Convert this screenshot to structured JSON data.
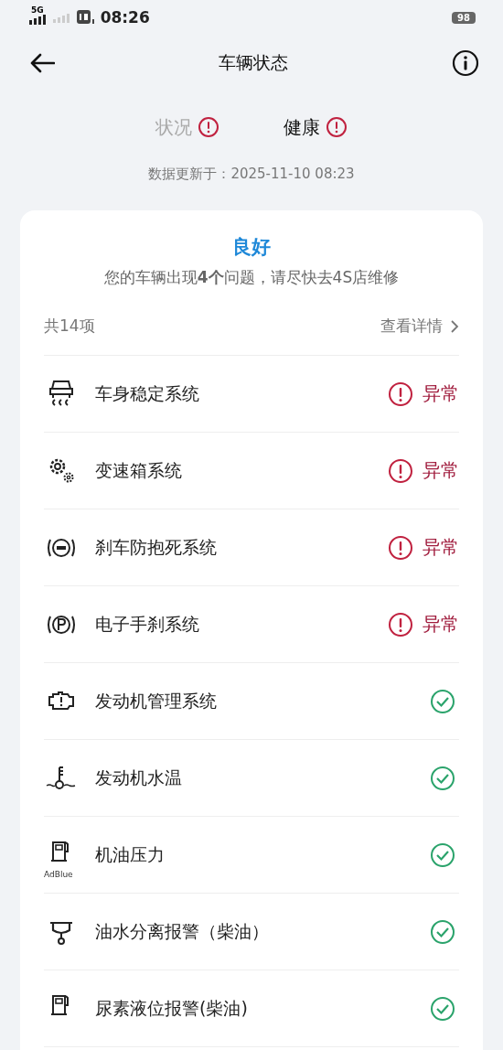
{
  "status_bar": {
    "network": "5G",
    "time": "08:26",
    "battery": "98"
  },
  "header": {
    "title": "车辆状态"
  },
  "tabs": [
    {
      "label": "状况",
      "selected": false,
      "alert": true
    },
    {
      "label": "健康",
      "selected": true,
      "alert": true
    }
  ],
  "updated": "数据更新于：2025-11-10  08:23",
  "summary": {
    "status": "良好",
    "message": "您的车辆出现**4个**问题，请尽快去4S店维修",
    "count": "共14项",
    "details_link": "查看详情"
  },
  "items": [
    {
      "name": "车身稳定系统",
      "abnormal": true,
      "status_text": "异常"
    },
    {
      "name": "变速箱系统",
      "abnormal": true,
      "status_text": "异常"
    },
    {
      "name": "刹车防抱死系统",
      "abnormal": true,
      "status_text": "异常"
    },
    {
      "name": "电子手刹系统",
      "abnormal": true,
      "status_text": "异常"
    },
    {
      "name": "发动机管理系统",
      "abnormal": false
    },
    {
      "name": "发动机水温",
      "abnormal": false
    },
    {
      "name": "机油压力",
      "abnormal": false,
      "icon_caption": "AdBlue"
    },
    {
      "name": "油水分离报警（柴油）",
      "abnormal": false
    },
    {
      "name": "尿素液位报警(柴油)",
      "abnormal": false
    }
  ]
}
